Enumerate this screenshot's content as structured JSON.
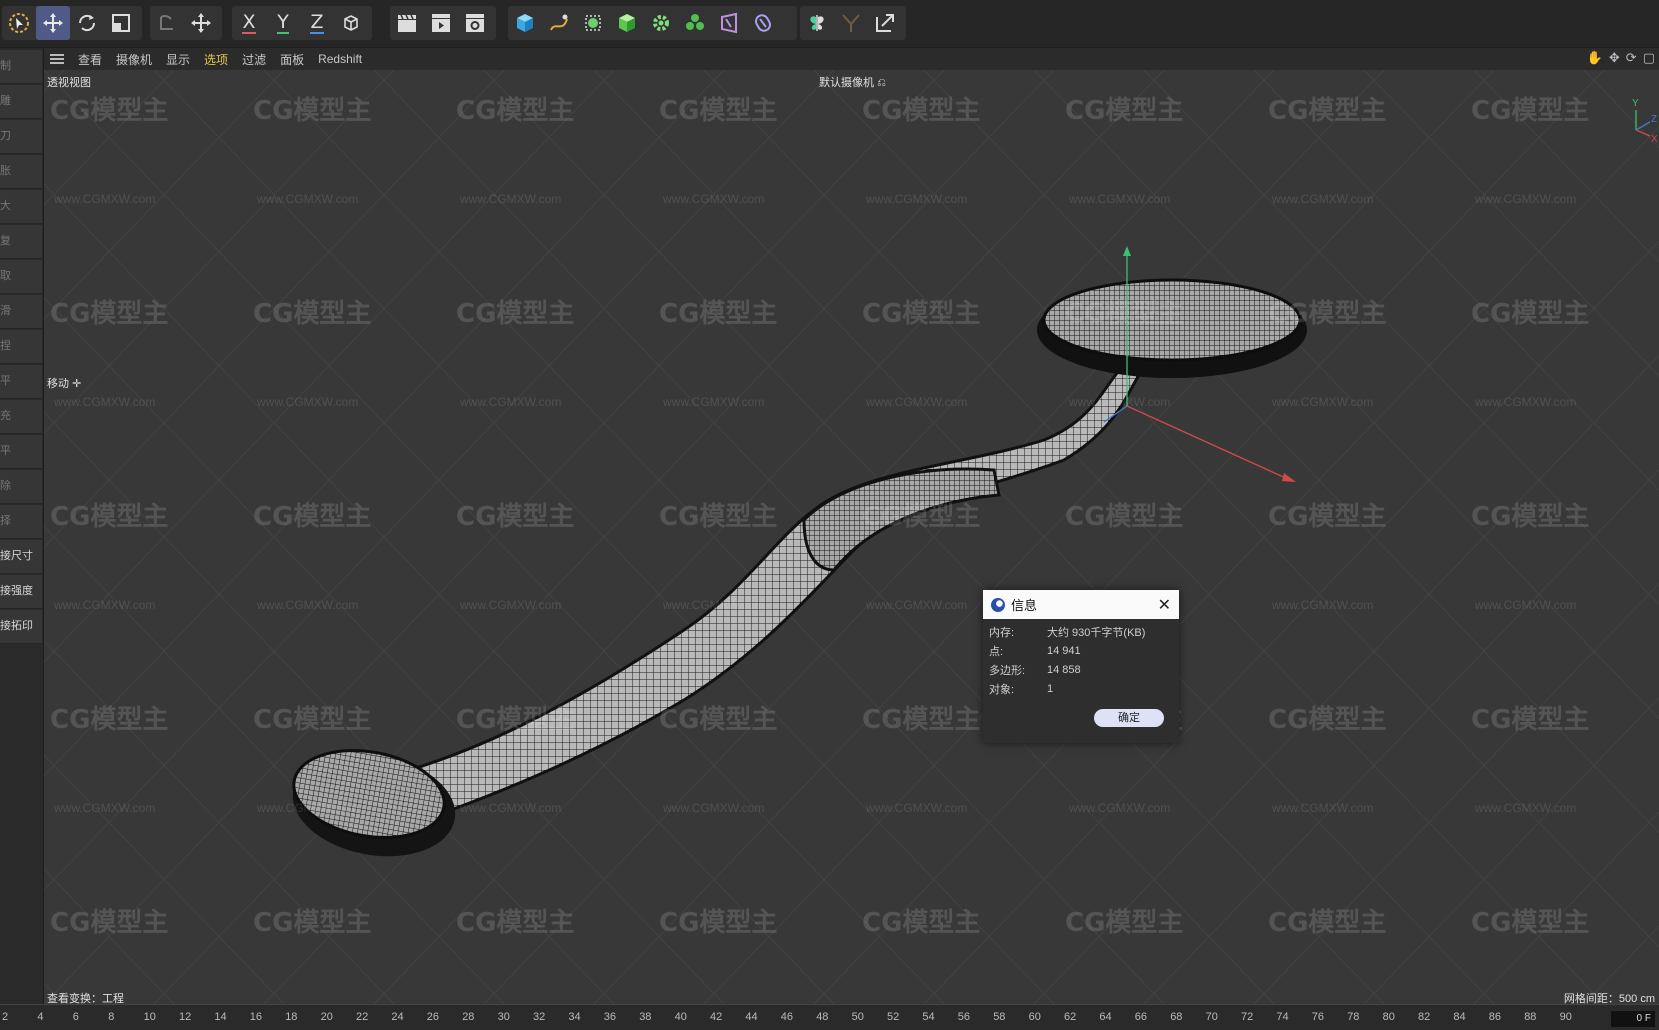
{
  "toolbar": {
    "axis_x": "X",
    "axis_y": "Y",
    "axis_z": "Z"
  },
  "left_panel": {
    "items": [
      "制",
      "雕",
      "刀",
      "胀",
      "大",
      "复",
      "取",
      "滑",
      "捏",
      "平",
      "充",
      "平",
      "除",
      "择",
      "接尺寸",
      "接强度",
      "接拓印"
    ]
  },
  "menu": {
    "items": [
      "查看",
      "摄像机",
      "显示",
      "选项",
      "过滤",
      "面板",
      "Redshift"
    ],
    "highlighted": "选项"
  },
  "viewport": {
    "view_name": "透视视图",
    "camera_label": "默认摄像机",
    "tool_label": "移动",
    "view_transform_label": "查看变换：工程",
    "grid_spacing": "网格间距：500 cm",
    "axis_labels": {
      "x": "X",
      "y": "Y",
      "z": "Z"
    }
  },
  "watermark": {
    "logo": "CG模型主",
    "url": "www.CGMXW.com"
  },
  "dialog": {
    "title": "信息",
    "rows": [
      {
        "label": "内存:",
        "value": "大约 930千字节(KB)"
      },
      {
        "label": "点:",
        "value": "14 941"
      },
      {
        "label": "多边形:",
        "value": "14 858"
      },
      {
        "label": "对象:",
        "value": "1"
      }
    ],
    "ok_label": "确定"
  },
  "timeline": {
    "ticks": [
      "2",
      "4",
      "6",
      "8",
      "10",
      "12",
      "14",
      "16",
      "18",
      "20",
      "22",
      "24",
      "26",
      "28",
      "30",
      "32",
      "34",
      "36",
      "38",
      "40",
      "42",
      "44",
      "46",
      "48",
      "50",
      "52",
      "54",
      "56",
      "58",
      "60",
      "62",
      "64",
      "66",
      "68",
      "70",
      "72",
      "74",
      "76",
      "78",
      "80",
      "82",
      "84",
      "86",
      "88",
      "90"
    ],
    "current_frame": "0 F"
  },
  "colors": {
    "accent": "#4f5b86",
    "menu_highlight": "#e6c84a",
    "axis_x": "#e05a5a",
    "axis_y": "#48c07a",
    "axis_z": "#4a8fe0"
  }
}
